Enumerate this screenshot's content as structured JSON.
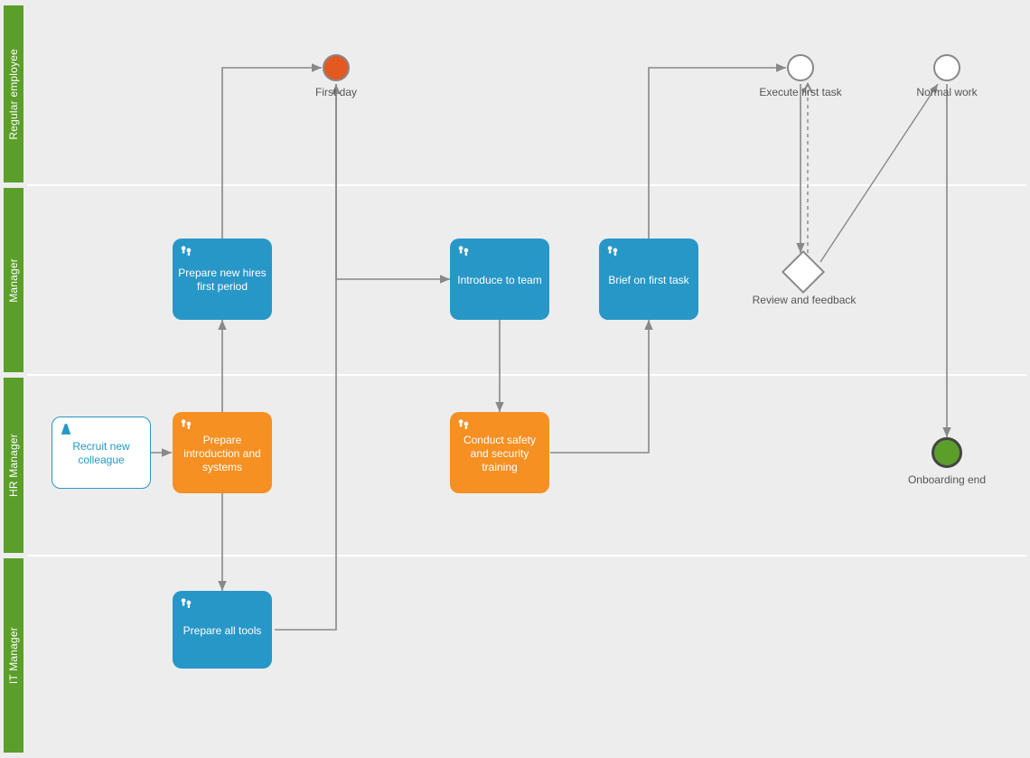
{
  "lanes": {
    "regular_employee": "Regular employee",
    "manager": "Manager",
    "hr_manager": "HR Manager",
    "it_manager": "IT Manager"
  },
  "nodes": {
    "recruit": "Recruit new colleague",
    "prepare_intro": "Prepare introduction and systems",
    "prepare_period": "Prepare new hires first period",
    "prepare_tools": "Prepare all tools",
    "first_day": "First day",
    "introduce": "Introduce to team",
    "conduct_training": "Conduct safety and security training",
    "brief": "Brief on first task",
    "execute": "Execute first task",
    "review": "Review and feedback",
    "normal_work": "Normal work",
    "onboarding_end": "Onboarding end"
  }
}
